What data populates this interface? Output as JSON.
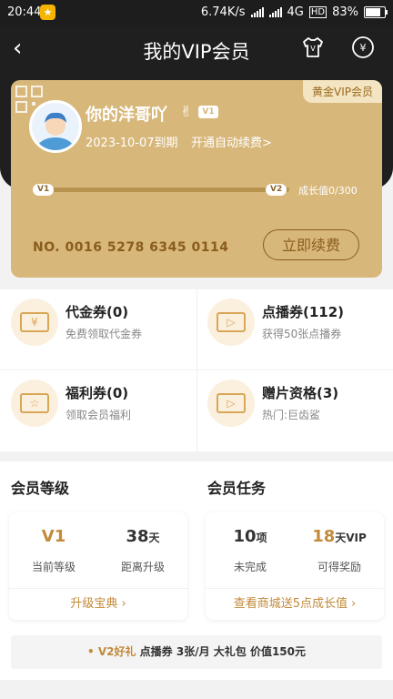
{
  "status": {
    "time": "20:44",
    "speed": "6.74K/s",
    "network": "4G",
    "hd": "HD",
    "battery": "83%",
    "app_badge": "★"
  },
  "nav": {
    "back": "‹",
    "title": "我的VIP会员"
  },
  "card": {
    "tag": "黄金VIP会员",
    "username": "你的洋哥吖",
    "level_badge": "V1",
    "expire": "2023-10-07到期",
    "auto_renew": "开通自动续费>",
    "level_start": "V1",
    "level_end": "V2",
    "growth": "成长值0/300",
    "progress": 0,
    "card_no": "NO. 0016 5278 6345 0114",
    "renew_button": "立即续费"
  },
  "coupons": [
    {
      "label": "代金券(0)",
      "sub": "免费领取代金券",
      "icon": "yuan-ticket-icon",
      "glyph": "¥"
    },
    {
      "label": "点播券(112)",
      "sub": "获得50张点播券",
      "icon": "play-ticket-icon",
      "glyph": "▷"
    },
    {
      "label": "福利券(0)",
      "sub": "领取会员福利",
      "icon": "star-ticket-icon",
      "glyph": "☆"
    },
    {
      "label": "赠片资格(3)",
      "sub": "热门:巨齿鲨",
      "icon": "gift-box-icon",
      "glyph": "▷"
    }
  ],
  "level_section": {
    "title": "会员等级",
    "current_value": "V1",
    "current_label": "当前等级",
    "days_value": "38",
    "days_unit": "天",
    "days_label": "距离升级",
    "footer": "升级宝典 ›"
  },
  "task_section": {
    "title": "会员任务",
    "count_value": "10",
    "count_unit": "项",
    "count_label": "未完成",
    "reward_value": "18",
    "reward_unit": "天VIP",
    "reward_label": "可得奖励",
    "footer": "查看商城送5点成长值 ›"
  },
  "gift_bar": {
    "prefix": "• V2好礼",
    "text": "点播券 3张/月  大礼包 价值150元"
  },
  "colors": {
    "gold_card": "#d8b77a",
    "gold_text": "#c28a3a",
    "dark_header": "#1f1f1f"
  }
}
